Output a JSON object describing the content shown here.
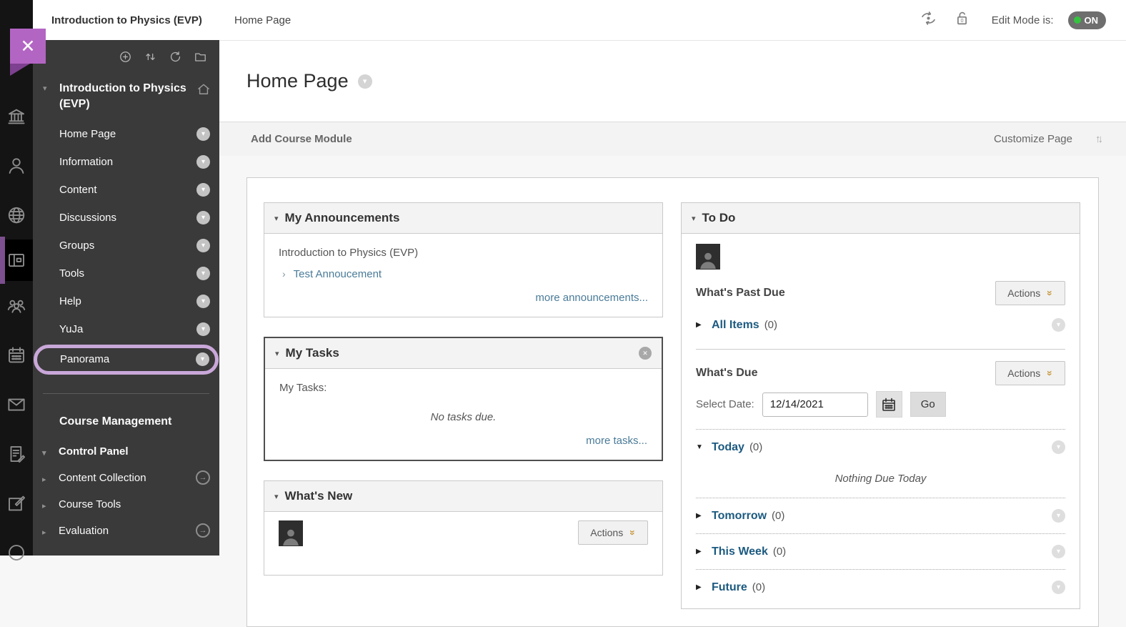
{
  "topbar": {
    "course_title": "Introduction to Physics (EVP)",
    "breadcrumb": "Home Page",
    "edit_mode_label": "Edit Mode is:",
    "edit_mode_value": "ON"
  },
  "annotation": {
    "close_label": "✕"
  },
  "sidebar": {
    "course_title": "Introduction to Physics (EVP)",
    "items": [
      "Home Page",
      "Information",
      "Content",
      "Discussions",
      "Groups",
      "Tools",
      "Help",
      "YuJa",
      "Panorama"
    ],
    "management_heading": "Course Management",
    "control_panel": "Control Panel",
    "management_items": [
      "Content Collection",
      "Course Tools",
      "Evaluation"
    ]
  },
  "page": {
    "title": "Home Page",
    "add_module": "Add Course Module",
    "customize": "Customize Page"
  },
  "modules": {
    "announcements": {
      "title": "My Announcements",
      "course": "Introduction to Physics (EVP)",
      "item": "Test Annoucement",
      "more": "more announcements..."
    },
    "tasks": {
      "title": "My Tasks",
      "label": "My Tasks:",
      "empty": "No tasks due.",
      "more": "more tasks..."
    },
    "whats_new": {
      "title": "What's New",
      "actions": "Actions"
    },
    "todo": {
      "title": "To Do",
      "past_due": "What's Past Due",
      "actions": "Actions",
      "all_items": "All Items",
      "all_items_count": "(0)",
      "whats_due": "What's Due",
      "select_date": "Select Date:",
      "date_value": "12/14/2021",
      "go": "Go",
      "nothing_due": "Nothing Due Today",
      "rows": [
        {
          "label": "Today",
          "count": "(0)"
        },
        {
          "label": "Tomorrow",
          "count": "(0)"
        },
        {
          "label": "This Week",
          "count": "(0)"
        },
        {
          "label": "Future",
          "count": "(0)"
        }
      ]
    }
  },
  "icons": {
    "caret_down": "▾",
    "caret_right": "▸",
    "tri_down": "▼",
    "tri_right": "▶",
    "close_x": "✕",
    "angle_right": "›",
    "updown_arrows": "↑↓",
    "double_chevron": "»",
    "arrow_right": "→"
  },
  "colors": {
    "annotation_purple": "#b365c3",
    "highlight_purple": "#c9a7d9",
    "link_blue": "#4a7b98",
    "section_link_blue": "#1c5a80",
    "edit_on_green": "#35c33f",
    "actions_chevron_gold": "#c79b43"
  }
}
